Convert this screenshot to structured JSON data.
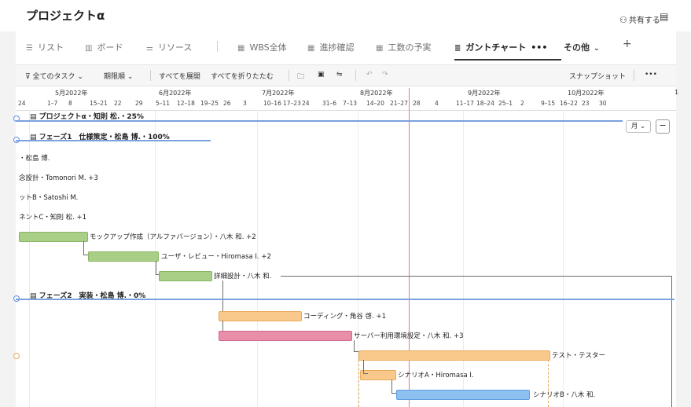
{
  "header": {
    "title": "プロジェクトα",
    "share_label": "共有する"
  },
  "tabs": [
    {
      "label": "リスト",
      "icon": "list-icon"
    },
    {
      "label": "ボード",
      "icon": "board-icon"
    },
    {
      "label": "リソース",
      "icon": "resource-icon"
    },
    {
      "label": "WBS全体",
      "icon": "table-icon"
    },
    {
      "label": "進捗確認",
      "icon": "table-icon"
    },
    {
      "label": "工数の予実",
      "icon": "table-icon"
    },
    {
      "label": "ガントチャート",
      "icon": "gantt-icon",
      "active": true
    },
    {
      "label": "その他",
      "icon": "chevron-down-icon"
    }
  ],
  "toolbar": {
    "filter_label": "全てのタスク",
    "sort_label": "期限順",
    "expand_label": "すべてを展開",
    "collapse_label": "すべてを折りたたむ",
    "snapshot_label": "スナップショット"
  },
  "timeline": {
    "months": [
      "5月2022年",
      "6月2022年",
      "7月2022年",
      "8月2022年",
      "9月2022年",
      "10月2022年"
    ],
    "weeks": [
      "24",
      "1–7",
      "8",
      "15–21",
      "22",
      "29",
      "5–11",
      "12–18",
      "19–25",
      "26",
      "3",
      "10–16",
      "17–23",
      "24",
      "31–6",
      "7–13",
      "14–20",
      "21–27",
      "28",
      "4",
      "11–17",
      "18–24",
      "25–1",
      "2",
      "9–15",
      "16–22",
      "23",
      "30"
    ],
    "scale_label": "月"
  },
  "rows": {
    "project": "プロジェクトα・知則 松.・25%",
    "phase1": "フェーズ1　仕様策定・松島 博.・100%",
    "task_a": "・松島 博.",
    "task_b": "念設計・Tomonori M. +3",
    "task_c": "ットB・Satoshi M.",
    "task_d": "ネントC・知則 松. +1",
    "mockup": "モックアップ作成（アルファバージョン）・八木 和. +2",
    "review": "ユーザ・レビュー・Hiromasa I. +2",
    "detail": "詳細設計・八木 和.",
    "phase2": "フェーズ2　実装・松島 博.・0%",
    "coding": "コーディング・角谷 啓. +1",
    "server": "サーバー利用環境設定・八木 和. +3",
    "test": "テスト・テスター",
    "scenarioA": "シナリオA・Hiromasa I.",
    "scenarioB": "シナリオB・八木 和."
  },
  "colors": {
    "accent": "#7aa1e0",
    "green": "#a9ce85",
    "orange": "#f8c98a",
    "pink": "#e98ea8",
    "blue": "#8ec0ef",
    "today": "#e07a7a"
  }
}
